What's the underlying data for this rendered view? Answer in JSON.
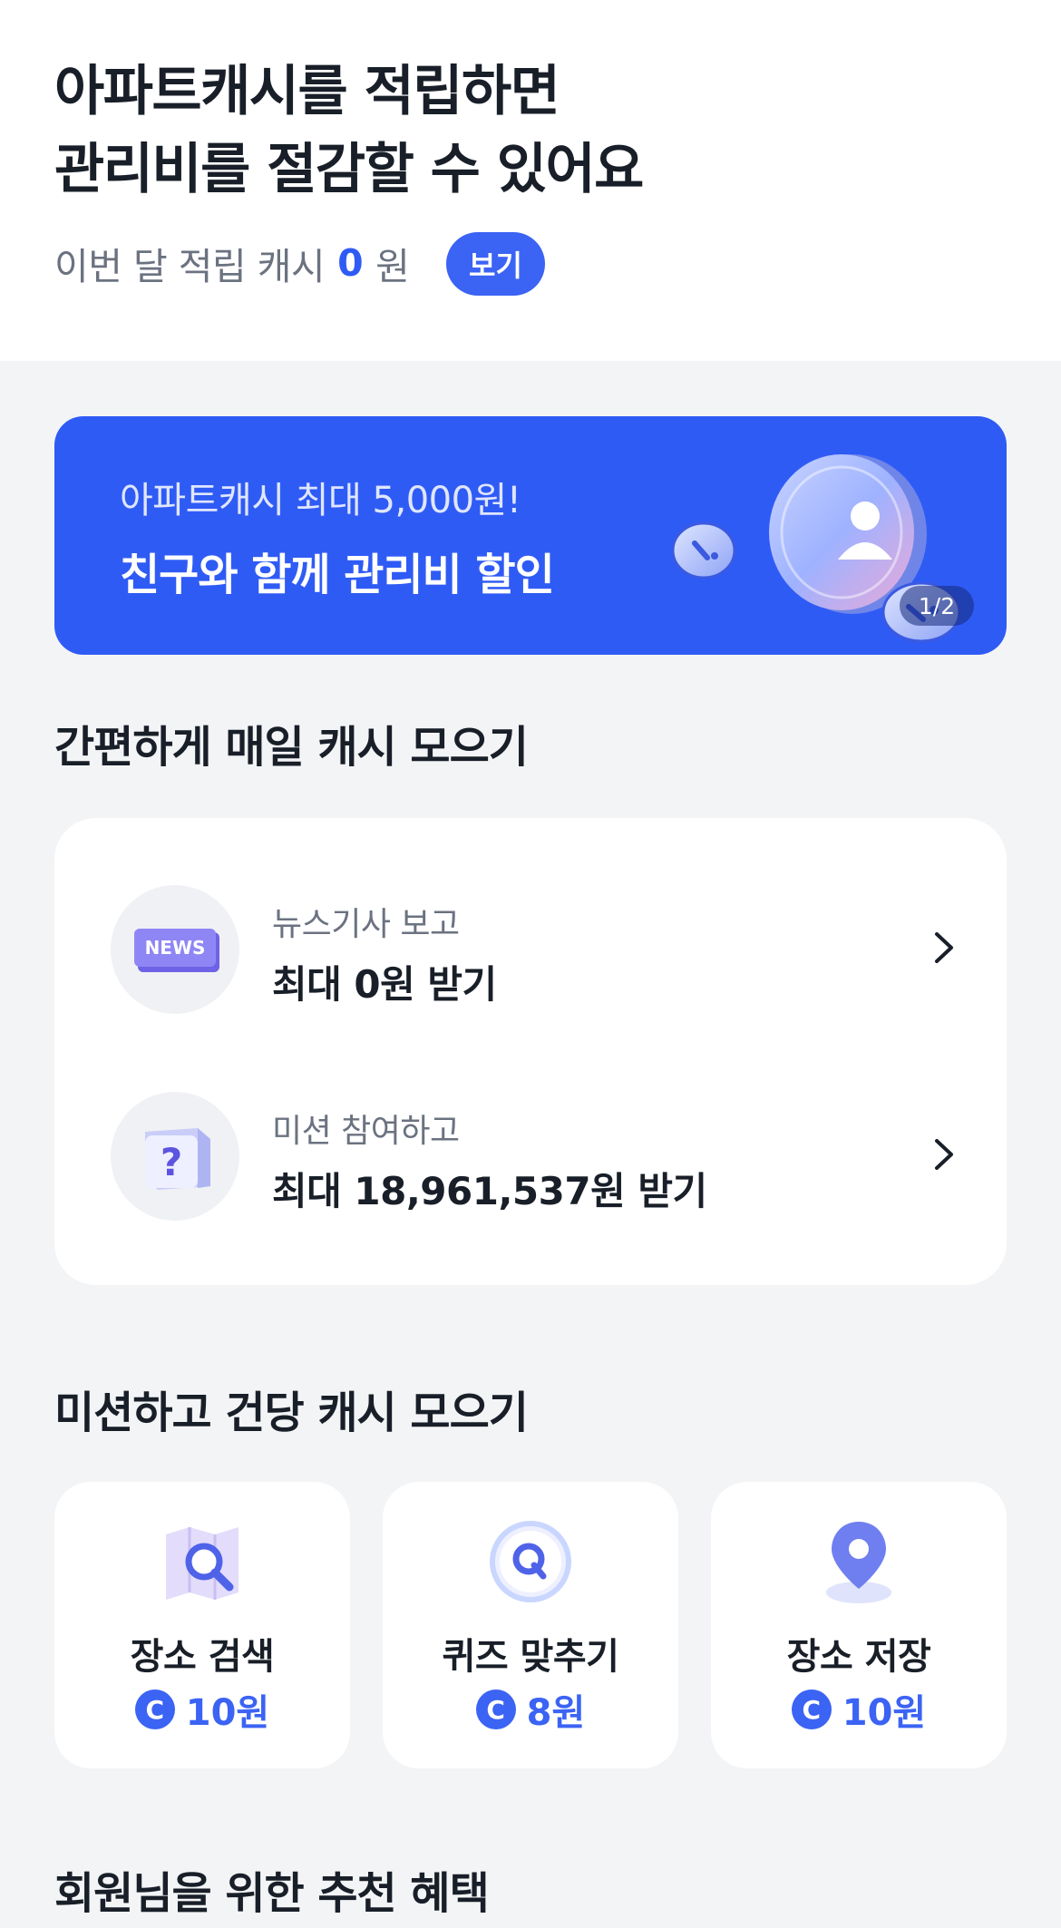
{
  "header": {
    "title_line1": "아파트캐시를 적립하면",
    "title_line2": "관리비를 절감할 수 있어요",
    "month_label": "이번 달 적립 캐시",
    "month_amount": "0",
    "month_unit": "원",
    "view_button": "보기"
  },
  "banner": {
    "subtitle": "아파트캐시 최대 5,000원!",
    "title": "친구와 함께 관리비 할인",
    "page_indicator": "1/2",
    "accent_color": "#2f5bf5"
  },
  "daily_section": {
    "title": "간편하게 매일 캐시 모으기",
    "items": [
      {
        "icon": "news-icon",
        "icon_text": "NEWS",
        "subtitle": "뉴스기사 보고",
        "title": "최대 0원 받기"
      },
      {
        "icon": "question-box-icon",
        "icon_text": "?",
        "subtitle": "미션 참여하고",
        "title": "최대 18,961,537원 받기"
      }
    ]
  },
  "mission_section": {
    "title": "미션하고 건당 캐시 모으기",
    "coin_symbol": "C",
    "items": [
      {
        "icon": "map-search-icon",
        "label": "장소 검색",
        "reward": "10원"
      },
      {
        "icon": "quiz-icon",
        "label": "퀴즈 맞추기",
        "reward": "8원"
      },
      {
        "icon": "location-pin-icon",
        "label": "장소 저장",
        "reward": "10원"
      }
    ]
  },
  "recommend_section": {
    "title": "회원님을 위한 추천 혜택"
  }
}
